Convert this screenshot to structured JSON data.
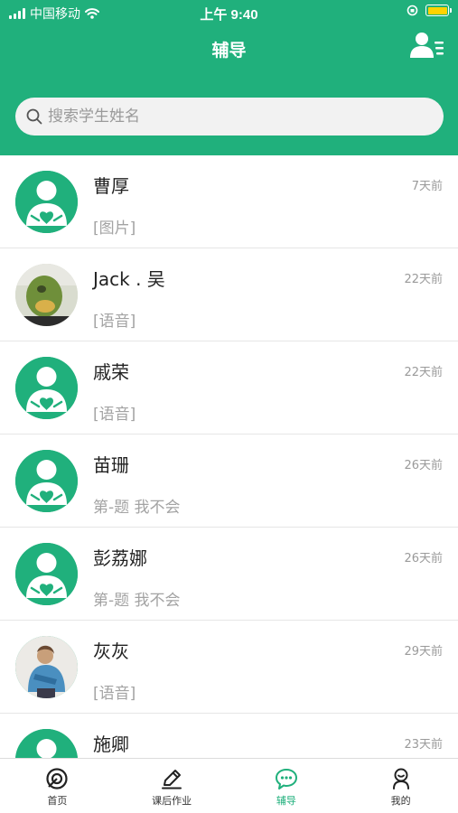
{
  "status_bar": {
    "carrier": "中国移动",
    "time": "上午 9:40"
  },
  "header": {
    "title": "辅导",
    "contacts_icon": "user-list-icon"
  },
  "search": {
    "placeholder": "搜索学生姓名",
    "value": ""
  },
  "students": [
    {
      "name": "曹厚",
      "time": "7天前",
      "last_message": "[图片]",
      "avatar": "default-student-avatar"
    },
    {
      "name": "Jack . 吴",
      "time": "22天前",
      "last_message": "[语音]",
      "avatar": "photo-avatar"
    },
    {
      "name": "戚荣",
      "time": "22天前",
      "last_message": "[语音]",
      "avatar": "default-student-avatar"
    },
    {
      "name": "苗珊",
      "time": "26天前",
      "last_message": "第-题 我不会",
      "avatar": "default-student-avatar"
    },
    {
      "name": "彭荔娜",
      "time": "26天前",
      "last_message": "第-题 我不会",
      "avatar": "default-student-avatar"
    },
    {
      "name": "灰灰",
      "time": "29天前",
      "last_message": "[语音]",
      "avatar": "photo-avatar"
    },
    {
      "name": "施卿",
      "time": "23天前",
      "last_message": "",
      "avatar": "default-student-avatar"
    }
  ],
  "tabs": [
    {
      "label": "首页",
      "icon": "home-icon",
      "active": false
    },
    {
      "label": "课后作业",
      "icon": "pencil-icon",
      "active": false
    },
    {
      "label": "辅导",
      "icon": "chat-bubble-icon",
      "active": true
    },
    {
      "label": "我的",
      "icon": "profile-icon",
      "active": false
    }
  ],
  "colors": {
    "brand": "#20b07c",
    "text_secondary": "#9a9a9a"
  }
}
